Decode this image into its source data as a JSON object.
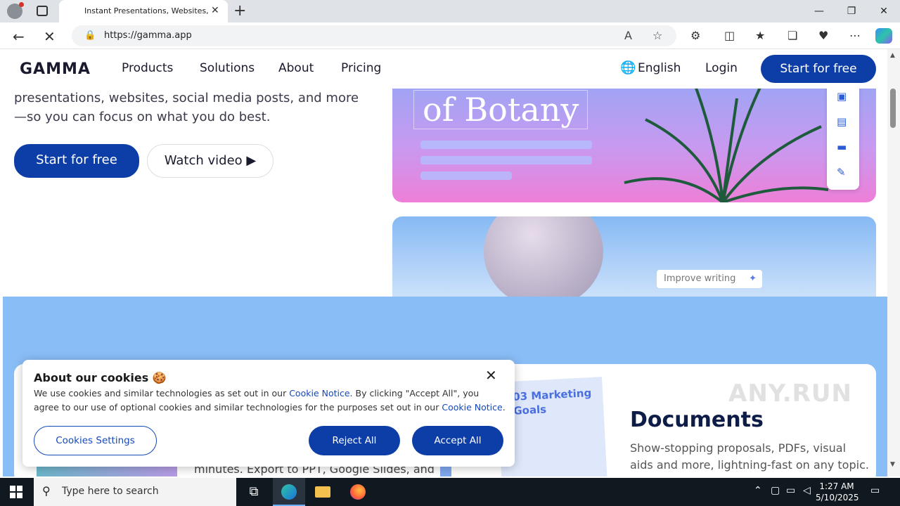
{
  "browser": {
    "tab_title": "Instant Presentations, Websites, a",
    "url": "https://gamma.app"
  },
  "header": {
    "logo": "GAMMA",
    "nav": [
      "Products",
      "Solutions",
      "About",
      "Pricing"
    ],
    "language": "English",
    "login": "Login",
    "cta": "Start for free"
  },
  "hero": {
    "text": "presentations, websites, social media posts, and more—so you can focus on what you do best.",
    "cta": "Start for free",
    "watch": "Watch video ▶"
  },
  "cards": {
    "botany_title": "of Botany",
    "improve": "Improve writing"
  },
  "features": {
    "doc_thumb_title": "03 Marketing Goals",
    "heading": "Documents",
    "desc": "Show-stopping proposals, PDFs, visual aids and more, lightning-fast on any topic.",
    "minutes": "minutes. Export to PPT, Google Slides, and"
  },
  "cookie": {
    "title": "About our cookies 🍪",
    "text_a": "We use cookies and similar technologies as set out in our ",
    "link1": "Cookie Notice",
    "text_b": ". By clicking \"Accept All\", you agree to our use of optional cookies and similar technologies for the purposes set out in our ",
    "link2": "Cookie Notice",
    "text_c": ".",
    "settings": "Cookies Settings",
    "reject": "Reject All",
    "accept": "Accept All"
  },
  "taskbar": {
    "search_placeholder": "Type here to search",
    "time": "1:27 AM",
    "date": "5/10/2025"
  },
  "watermark": "ANY.RUN"
}
